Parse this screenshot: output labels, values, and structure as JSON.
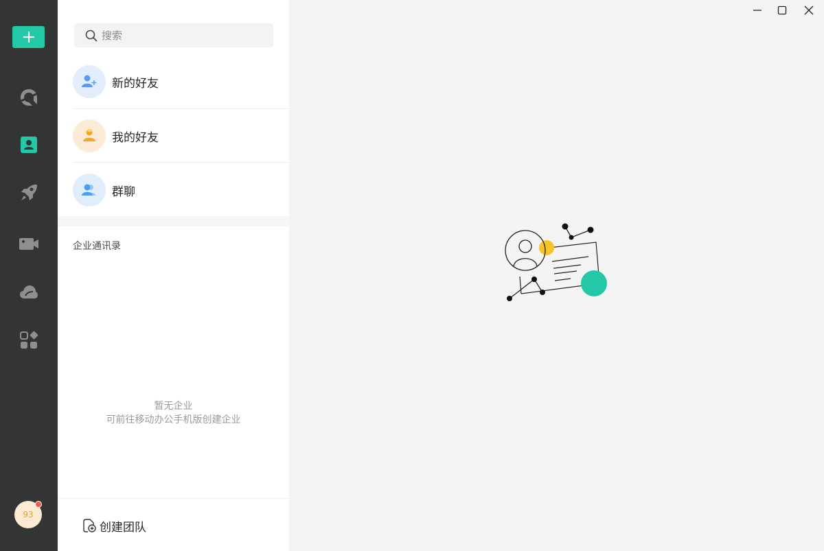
{
  "rail": {
    "items": [
      {
        "name": "messages"
      },
      {
        "name": "contacts",
        "active": true
      },
      {
        "name": "workplace"
      },
      {
        "name": "meeting"
      },
      {
        "name": "cloud-drive"
      },
      {
        "name": "apps"
      }
    ],
    "avatar_text": "93",
    "accent_color": "#24c7a6",
    "background_color": "#333534"
  },
  "search": {
    "placeholder": "搜索"
  },
  "contacts": {
    "entries": [
      {
        "label": "新的好友",
        "icon": "add-friend-icon",
        "color": "#5b9cf0"
      },
      {
        "label": "我的好友",
        "icon": "my-friends-icon",
        "color": "#f5a623"
      },
      {
        "label": "群聊",
        "icon": "group-chat-icon",
        "color": "#4a9ff0"
      }
    ],
    "section_title": "企业通讯录",
    "empty_line1": "暂无企业",
    "empty_line2": "可前往移动办公手机版创建企业",
    "create_team_label": "创建团队"
  },
  "window": {
    "minimize": "minimize",
    "maximize": "maximize",
    "close": "close"
  }
}
